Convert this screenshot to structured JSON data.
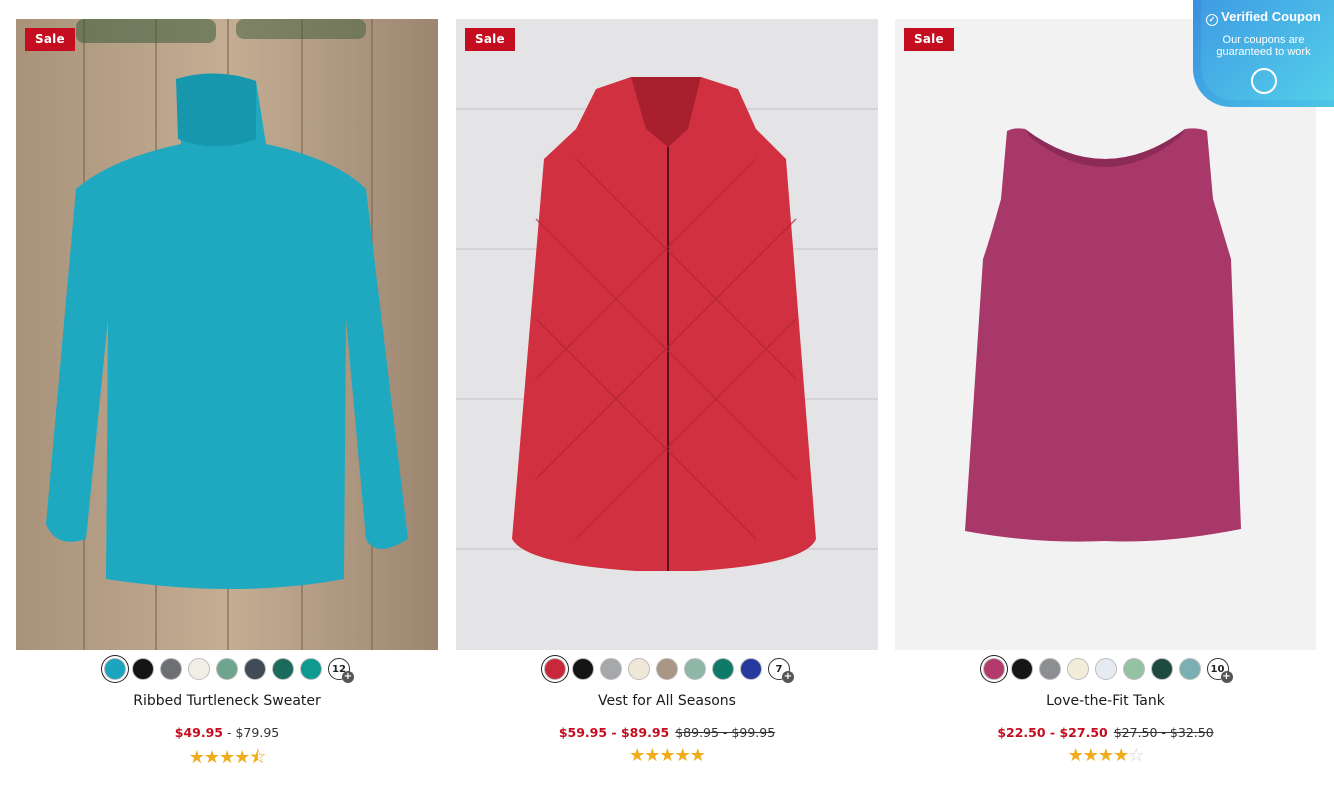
{
  "products": [
    {
      "badge": "Sale",
      "name": "Ribbed Turtleneck Sweater",
      "price_now": "$49.95",
      "price_sep": " - ",
      "price_reg": "$79.95",
      "price_was": "",
      "more_colors": "12",
      "rating": 4.5,
      "stars_on": "★★★★",
      "stars_half": "⯪",
      "stars_off": "",
      "swatch_colors": [
        "#1aa4bd",
        "#151515",
        "#6d6f74",
        "#f1eee6",
        "#6ea58f",
        "#414b56",
        "#1c6a5c",
        "#0f9a8f"
      ]
    },
    {
      "badge": "Sale",
      "name": "Vest for All Seasons",
      "price_now": "$59.95 - $89.95",
      "price_sep": "",
      "price_reg": "",
      "price_was": "$89.95 - $99.95",
      "more_colors": "7",
      "rating": 5,
      "stars_on": "★★★★★",
      "stars_half": "",
      "stars_off": "",
      "swatch_colors": [
        "#c8283a",
        "#151515",
        "#a6a8ab",
        "#efe8d6",
        "#a99685",
        "#8fb7a8",
        "#0f7a68",
        "#26399e"
      ]
    },
    {
      "badge": "Sale",
      "name": "Love-the-Fit Tank",
      "price_now": "$22.50 - $27.50",
      "price_sep": "",
      "price_reg": "",
      "price_was": "$27.50 - $32.50",
      "more_colors": "10",
      "rating": 4,
      "stars_on": "★★★★",
      "stars_half": "",
      "stars_off": "☆",
      "swatch_colors": [
        "#b33a6c",
        "#151515",
        "#8c8e91",
        "#f2edda",
        "#e6eaf1",
        "#94c2a3",
        "#1f4a3f",
        "#7ab0b2"
      ]
    }
  ],
  "coupon": {
    "title": "Verified Coupon",
    "line1": "Our coupons are",
    "line2": "guaranteed to work"
  },
  "icons": {
    "coupon_check": "check-circle-icon",
    "coupon_logo": "chat-logo-icon",
    "more_plus": "plus-icon"
  }
}
